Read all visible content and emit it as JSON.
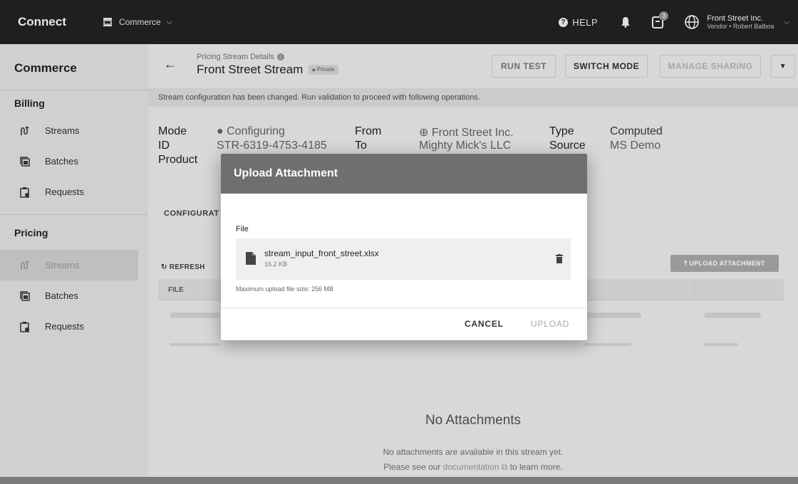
{
  "topbar": {
    "brand": "Connect",
    "context": "Commerce",
    "help_label": "HELP",
    "notifications_count": "3",
    "account_name": "Front Street Inc.",
    "account_sub": "Vendor • Robert Balboa"
  },
  "sidebar": {
    "title": "Commerce",
    "sections": [
      {
        "label": "Billing",
        "items": [
          {
            "label": "Streams"
          },
          {
            "label": "Batches"
          },
          {
            "label": "Requests"
          }
        ]
      },
      {
        "label": "Pricing",
        "items": [
          {
            "label": "Streams"
          },
          {
            "label": "Batches"
          },
          {
            "label": "Requests"
          }
        ]
      }
    ]
  },
  "header": {
    "breadcrumb": "Pricing Stream Details",
    "title": "Front Street Stream",
    "badge": "Private",
    "buttons": {
      "run_test": "RUN TEST",
      "switch_mode": "SWITCH MODE",
      "manage_sharing": "MANAGE SHARING"
    }
  },
  "banner": "Stream configuration has been changed. Run validation to proceed with following operations.",
  "details": {
    "mode_label": "Mode",
    "mode_value": "Configuring",
    "id_label": "ID",
    "id_value": "STR-6319-4753-4185",
    "product_label": "Product",
    "from_label": "From",
    "from_value": "Front Street Inc.",
    "to_label": "To",
    "to_value": "Mighty Mick's LLC",
    "type_label": "Type",
    "type_value": "Computed",
    "source_label": "Source",
    "source_value": "MS Demo"
  },
  "section_title": "CONFIGURAT",
  "toolbar": {
    "refresh": "REFRESH",
    "upload_attachment": "UPLOAD ATTACHMENT"
  },
  "table": {
    "file_header": "FILE"
  },
  "empty": {
    "title": "No Attachments",
    "line1": "No attachments are available in this stream yet.",
    "line2_pre": "Please see our",
    "link": "documentation",
    "line2_post": "to learn more."
  },
  "modal": {
    "title": "Upload Attachment",
    "field_label": "File",
    "file_name": "stream_input_front_street.xlsx",
    "file_size": "16.2 KB",
    "max_size": "Maximum upload file size: 256 MB",
    "cancel": "CANCEL",
    "upload": "UPLOAD"
  },
  "icons": [
    "store-icon",
    "help-icon",
    "bell-icon",
    "notifications-icon",
    "globe-icon",
    "streams-icon",
    "batches-icon",
    "requests-icon",
    "file-icon",
    "trash-icon",
    "refresh-icon",
    "upload-icon",
    "back-arrow-icon"
  ]
}
